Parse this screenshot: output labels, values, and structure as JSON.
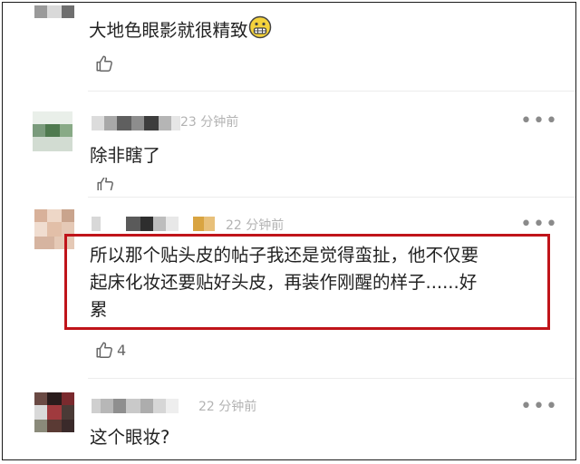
{
  "comments": [
    {
      "text": "大地色眼影就很精致",
      "emoji": "grimacing-face-emoji",
      "like_icon": "thumbs-up-icon",
      "like_count": ""
    },
    {
      "time": "23 分钟前",
      "text": "除非瞎了",
      "like_icon": "thumbs-up-icon",
      "more_icon": "more-dots-icon",
      "more_label": "•••"
    },
    {
      "time": "22 分钟前",
      "text_lines": [
        "所以那个贴头皮的帖子我还是觉得蛮扯，他不仅要",
        "起床化妆还要贴好头皮，再装作刚醒的样子......好",
        "累"
      ],
      "like_icon": "thumbs-up-icon",
      "like_count": "4",
      "more_icon": "more-dots-icon",
      "more_label": "•••"
    },
    {
      "time": "22 分钟前",
      "text": "这个眼妆?",
      "more_icon": "more-dots-icon",
      "more_label": "•••"
    }
  ],
  "colors": {
    "highlight_border": "#c0141a",
    "time_text": "#b3b3b3",
    "divider": "#ececec"
  }
}
